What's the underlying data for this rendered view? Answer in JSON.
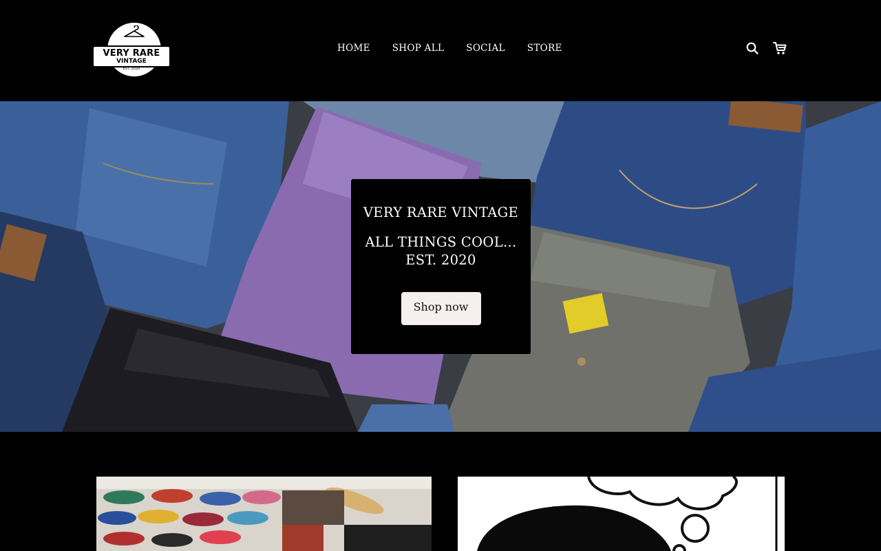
{
  "brand": {
    "logo_top": "VERY RARE",
    "logo_bottom": "VINTAGE",
    "logo_est": "EST. 2020"
  },
  "nav": {
    "items": [
      {
        "label": "HOME"
      },
      {
        "label": "SHOP ALL"
      },
      {
        "label": "SOCIAL"
      },
      {
        "label": "STORE"
      }
    ]
  },
  "header_icons": {
    "search": "search-icon",
    "cart": "cart-icon"
  },
  "hero": {
    "title": "VERY RARE VINTAGE",
    "subtitle_line1": "ALL THINGS COOL...",
    "subtitle_line2": "EST. 2020",
    "cta_label": "Shop now"
  },
  "colors": {
    "background": "#000000",
    "button_bg": "#f6efef",
    "text": "#ffffff"
  }
}
